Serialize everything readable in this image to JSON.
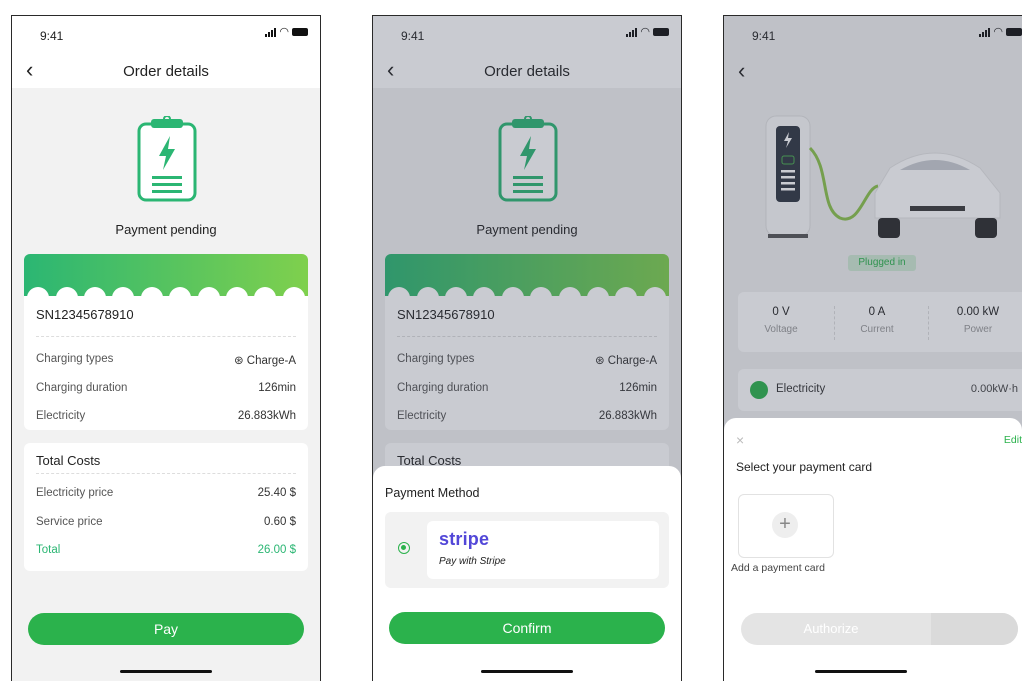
{
  "status_time": "9:41",
  "order": {
    "nav_title": "Order details",
    "payment_status": "Payment pending",
    "serial": "SN12345678910",
    "rows": [
      {
        "label": "Charging types",
        "value": "Charge-A"
      },
      {
        "label": "Charging duration",
        "value": "126min"
      },
      {
        "label": "Electricity",
        "value": "26.883kWh"
      }
    ],
    "costs_title": "Total Costs",
    "costs": [
      {
        "label": "Electricity price",
        "value": "25.40 $"
      },
      {
        "label": "Service price",
        "value": "0.60 $"
      },
      {
        "label": "Total",
        "value": "26.00 $"
      }
    ],
    "pay_label": "Pay"
  },
  "payment_sheet": {
    "title": "Payment Method",
    "stripe_logo": "stripe",
    "stripe_sub": "Pay with Stripe",
    "confirm_label": "Confirm"
  },
  "charging": {
    "plug_status": "Plugged in",
    "stats": [
      {
        "value": "0 V",
        "label": "Voltage"
      },
      {
        "value": "0 A",
        "label": "Current"
      },
      {
        "value": "0.00 kW",
        "label": "Power"
      }
    ],
    "electricity_label": "Electricity",
    "electricity_value": "0.00kW·h"
  },
  "card_sheet": {
    "close_icon": "×",
    "edit_label": "Edit",
    "title": "Select your payment card",
    "add_label": "Add a payment card",
    "authorize_label": "Authorize"
  },
  "colors": {
    "accent": "#2bb24c",
    "stripe": "#5247d8"
  },
  "icons": [
    "signal-icon",
    "wifi-icon",
    "battery-icon",
    "back-chevron-icon",
    "clipboard-bolt-icon",
    "charge-a-plug-icon",
    "radio-selected-icon",
    "close-icon",
    "plus-icon",
    "bolt-icon"
  ]
}
